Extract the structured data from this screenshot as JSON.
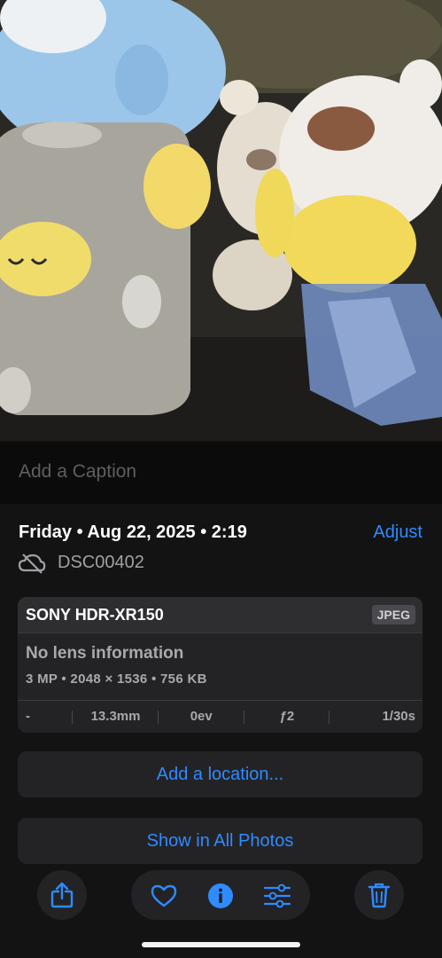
{
  "photo": {
    "subject": "toy figures photo"
  },
  "caption": {
    "placeholder": "Add a Caption"
  },
  "info": {
    "date": "Friday • Aug 22, 2025 • 2:19",
    "adjust_label": "Adjust",
    "filename": "DSC00402"
  },
  "camera": {
    "name": "SONY HDR-XR150",
    "format": "JPEG",
    "lens": "No lens information",
    "specs": "3 MP • 2048 × 1536 • 756 KB",
    "exif": [
      "-",
      "13.3mm",
      "0ev",
      "ƒ2",
      "1/30s"
    ]
  },
  "actions": {
    "add_location": "Add a location...",
    "show_all": "Show in All Photos"
  },
  "toolbar": {
    "icons": [
      "share-icon",
      "heart-icon",
      "info-icon",
      "adjust-sliders-icon",
      "trash-icon"
    ]
  },
  "colors": {
    "accent": "#2f8bff",
    "background": "#131313",
    "card": "#232326"
  }
}
